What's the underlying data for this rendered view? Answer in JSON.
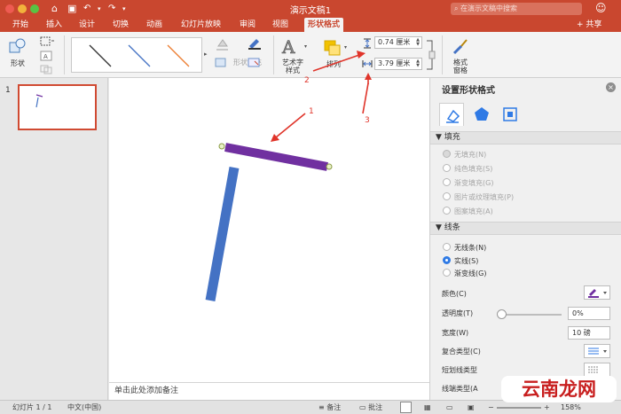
{
  "window": {
    "title": "演示文稿1",
    "search_placeholder": "在演示文稿中搜索",
    "share_label": "+ 共享"
  },
  "tabs": [
    {
      "label": "开始"
    },
    {
      "label": "插入"
    },
    {
      "label": "设计"
    },
    {
      "label": "切换"
    },
    {
      "label": "动画"
    },
    {
      "label": "幻灯片放映"
    },
    {
      "label": "审阅"
    },
    {
      "label": "视图"
    },
    {
      "label": "形状格式",
      "active": true
    }
  ],
  "ribbon": {
    "shape_label": "形状",
    "shape_fill_label": "形状填充",
    "wordart_label": "艺术字\n样式",
    "arrange_label": "排列",
    "height_value": "0.74 厘米",
    "width_value": "3.79 厘米",
    "format_pane_label": "格式\n窗格",
    "gallery_line_colors": [
      "#333333",
      "#4472c4",
      "#ed7d31"
    ]
  },
  "slides_panel": {
    "slide_number": "1"
  },
  "canvas": {
    "annotations": [
      "1",
      "2",
      "3"
    ],
    "annotation_color": "#e0342a",
    "purple_line_color": "#7030a0",
    "blue_line_color": "#4472c4",
    "notes_placeholder": "单击此处添加备注"
  },
  "format_pane": {
    "title": "设置形状格式",
    "fill_section": "填充",
    "fill_options": [
      {
        "label": "无填充(N)",
        "checked": true
      },
      {
        "label": "纯色填充(S)",
        "checked": false
      },
      {
        "label": "渐变填充(G)",
        "checked": false
      },
      {
        "label": "图片或纹理填充(P)",
        "checked": false
      },
      {
        "label": "图案填充(A)",
        "checked": false
      }
    ],
    "line_section": "线条",
    "line_options": [
      {
        "label": "无线条(N)",
        "checked": false
      },
      {
        "label": "实线(S)",
        "checked": true
      },
      {
        "label": "渐变线(G)",
        "checked": false
      }
    ],
    "color_label": "颜色(C)",
    "transparency_label": "透明度(T)",
    "transparency_value": "0%",
    "transparency_level": 0,
    "width_label": "宽度(W)",
    "width_value": "10 磅",
    "compound_label": "复合类型(C)",
    "dash_label": "短划线类型",
    "cap_label": "线端类型(A"
  },
  "statusbar": {
    "slide_info": "幻灯片 1 / 1",
    "language": "中文(中国)",
    "notes_label": "备注",
    "comments_label": "批注",
    "zoom": "158%"
  },
  "watermark": "云南龙网"
}
